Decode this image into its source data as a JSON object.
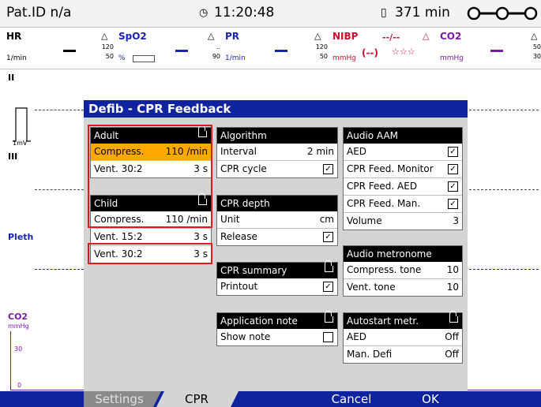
{
  "status": {
    "patient_id": "Pat.ID n/a",
    "time": "11:20:48",
    "battery_time": "371 min"
  },
  "params": {
    "hr": {
      "label": "HR",
      "unit": "1/min"
    },
    "spo2": {
      "label": "SpO2",
      "unit": "%",
      "hi": "120",
      "lo": "50"
    },
    "pr": {
      "label": "PR",
      "unit": "1/min",
      "hi": "..",
      "lo": "90"
    },
    "nibp": {
      "label": "NIBP",
      "unit": "mmHg",
      "hi": "120",
      "lo": "50",
      "value": "--/--",
      "sub": "(--)",
      "stars": "☆☆☆"
    },
    "co2": {
      "label": "CO2",
      "unit": "mmHg",
      "hi": "50",
      "lo": "30"
    }
  },
  "waves": {
    "ecg_ii": "II",
    "scale": "1mV",
    "ecg_iii": "III",
    "pleth": "Pleth",
    "co2": "CO2",
    "co2_unit": "mmHg",
    "co2_tick": "30",
    "co2_zero": "0"
  },
  "dialog": {
    "title": "Defib - CPR Feedback",
    "adult": {
      "header": "Adult",
      "compress_label": "Compress.",
      "compress_value": "110 /min",
      "vent_label": "Vent. 30:2",
      "vent_value": "3 s"
    },
    "child": {
      "header": "Child",
      "compress_label": "Compress.",
      "compress_value": "110 /min",
      "vent1_label": "Vent. 15:2",
      "vent1_value": "3 s",
      "vent2_label": "Vent. 30:2",
      "vent2_value": "3 s"
    },
    "algorithm": {
      "header": "Algorithm",
      "interval_label": "Interval",
      "interval_value": "2 min",
      "cycle_label": "CPR cycle"
    },
    "depth": {
      "header": "CPR depth",
      "unit_label": "Unit",
      "unit_value": "cm",
      "release_label": "Release"
    },
    "summary": {
      "header": "CPR summary",
      "printout_label": "Printout"
    },
    "appnote": {
      "header": "Application note",
      "show_label": "Show note"
    },
    "audio_aam": {
      "header": "Audio AAM",
      "items": [
        "AED",
        "CPR Feed. Monitor",
        "CPR Feed. AED",
        "CPR Feed. Man."
      ],
      "volume_label": "Volume",
      "volume_value": "3"
    },
    "metronome": {
      "header": "Audio metronome",
      "compress_label": "Compress. tone",
      "compress_value": "10",
      "vent_label": "Vent. tone",
      "vent_value": "10"
    },
    "autostart": {
      "header": "Autostart metr.",
      "aed_label": "AED",
      "aed_value": "Off",
      "man_label": "Man. Defi",
      "man_value": "Off"
    }
  },
  "softkeys": {
    "settings": "Settings",
    "cpr": "CPR",
    "cancel": "Cancel",
    "ok": "OK"
  },
  "colors": {
    "accent_blue": "#10239e",
    "selected": "#ffa800",
    "alarm_red": "#c8102e",
    "param_blue": "#1a24b0",
    "param_purple": "#7a1aa8",
    "highlight_box": "#e01919"
  }
}
